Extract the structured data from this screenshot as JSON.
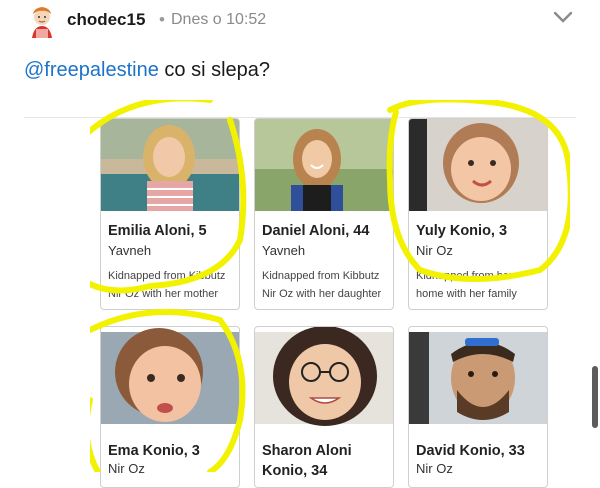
{
  "post": {
    "username": "chodec15",
    "separator": "•",
    "timestamp": "Dnes o 10:52",
    "mention": "@freepalestine",
    "message": "co si slepa?"
  },
  "cards": [
    {
      "name": "Emilia Aloni, 5",
      "place": "Yavneh",
      "description": "Kidnapped from Kibbutz Nir Oz with her mother",
      "photo": "girl-blonde-striped-top"
    },
    {
      "name": "Daniel Aloni, 44",
      "place": "Yavneh",
      "description": "Kidnapped from Kibbutz Nir Oz with her daughter",
      "photo": "woman-smiling-outdoors"
    },
    {
      "name": "Yuly Konio, 3",
      "place": "Nir Oz",
      "description": "Kidnapped from her home with her family",
      "photo": "toddler-pigtails"
    },
    {
      "name": "Ema Konio, 3",
      "place": "Nir Oz",
      "description": "",
      "photo": "toddler-close-up"
    },
    {
      "name": "Sharon Aloni Konio, 34",
      "place": "",
      "description": "",
      "photo": "woman-glasses-smiling"
    },
    {
      "name": "David Konio, 33",
      "place": "Nir Oz",
      "description": "",
      "photo": "man-with-sunglasses"
    }
  ],
  "colors": {
    "highlight": "#f2f200",
    "mention": "#1d73c9"
  },
  "icons": {
    "chevron": "chevron-down-icon",
    "avatar": "cartoon-avatar"
  }
}
